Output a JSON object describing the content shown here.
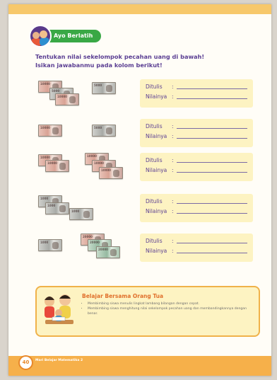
{
  "header": {
    "title": "Ayo Berlatih"
  },
  "instruction": {
    "line1": "Tentukan nilai sekelompok pecahan uang di bawah!",
    "line2": "Isikan jawabanmu pada kolom berikut!"
  },
  "answer_labels": {
    "ditulis": "Ditulis",
    "nilainya": "Nilainya",
    "colon": ":"
  },
  "rows": [
    {
      "notes": [
        "10000",
        "5000",
        "10000",
        "5000"
      ]
    },
    {
      "notes": [
        "10000",
        "5000"
      ]
    },
    {
      "notes": [
        "10000",
        "10000",
        "10000",
        "10000",
        "10000"
      ]
    },
    {
      "notes": [
        "1000",
        "1000",
        "1000"
      ]
    },
    {
      "notes": [
        "1000",
        "20000",
        "20000",
        "20000"
      ]
    }
  ],
  "parent_box": {
    "title": "Belajar Bersama Orang Tua",
    "bullets": [
      "Membimbing siswa menulis lingkat lambang bilangan dengan cepat.",
      "Membimbing siswa menghitung nilai sekelompok pecahan uang dan membandingkannya dengan benar."
    ]
  },
  "footer": {
    "page_number": "40",
    "text": "Mari Belajar Matematika 2"
  },
  "colors": {
    "accent_green": "#39a845",
    "text_purple": "#5b3f93",
    "orange": "#f6b04a",
    "answer_bg": "#fdf3c2"
  }
}
